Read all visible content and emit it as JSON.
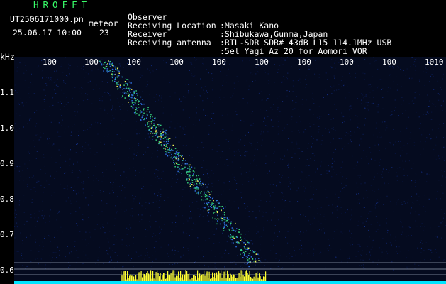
{
  "header": {
    "app_title": "HROFFT",
    "filename": "UT2506171000.pn",
    "tag": "meteor",
    "datetime": "25.06.17 10:00",
    "count": "23"
  },
  "info": [
    {
      "key": "Observer",
      "value": ":Masaki Kano"
    },
    {
      "key": "Receiving Location",
      "value": ":Shibukawa,Gunma,Japan"
    },
    {
      "key": "Receiver",
      "value": ":RTL-SDR SDR# 43dB L15 114.1MHz USB"
    },
    {
      "key": "Receiving antenna",
      "value": ":5el Yagi Az 20 for Aomori VOR"
    }
  ],
  "axis": {
    "unit": "kHz",
    "y_ticks": [
      "1.1",
      "1.0",
      "0.9",
      "0.8",
      "0.7",
      "0.6"
    ],
    "x_ticks": [
      "100",
      "100",
      "100",
      "100",
      "100",
      "100",
      "100",
      "100",
      "100",
      "1010"
    ]
  },
  "colors": {
    "title": "#39ff6a",
    "noise": "#0a1a55",
    "trace": "#35d07a",
    "trace_hot": "#f2f25a",
    "spectrum": "#ffff33",
    "baseline": "#00e5ff"
  }
}
